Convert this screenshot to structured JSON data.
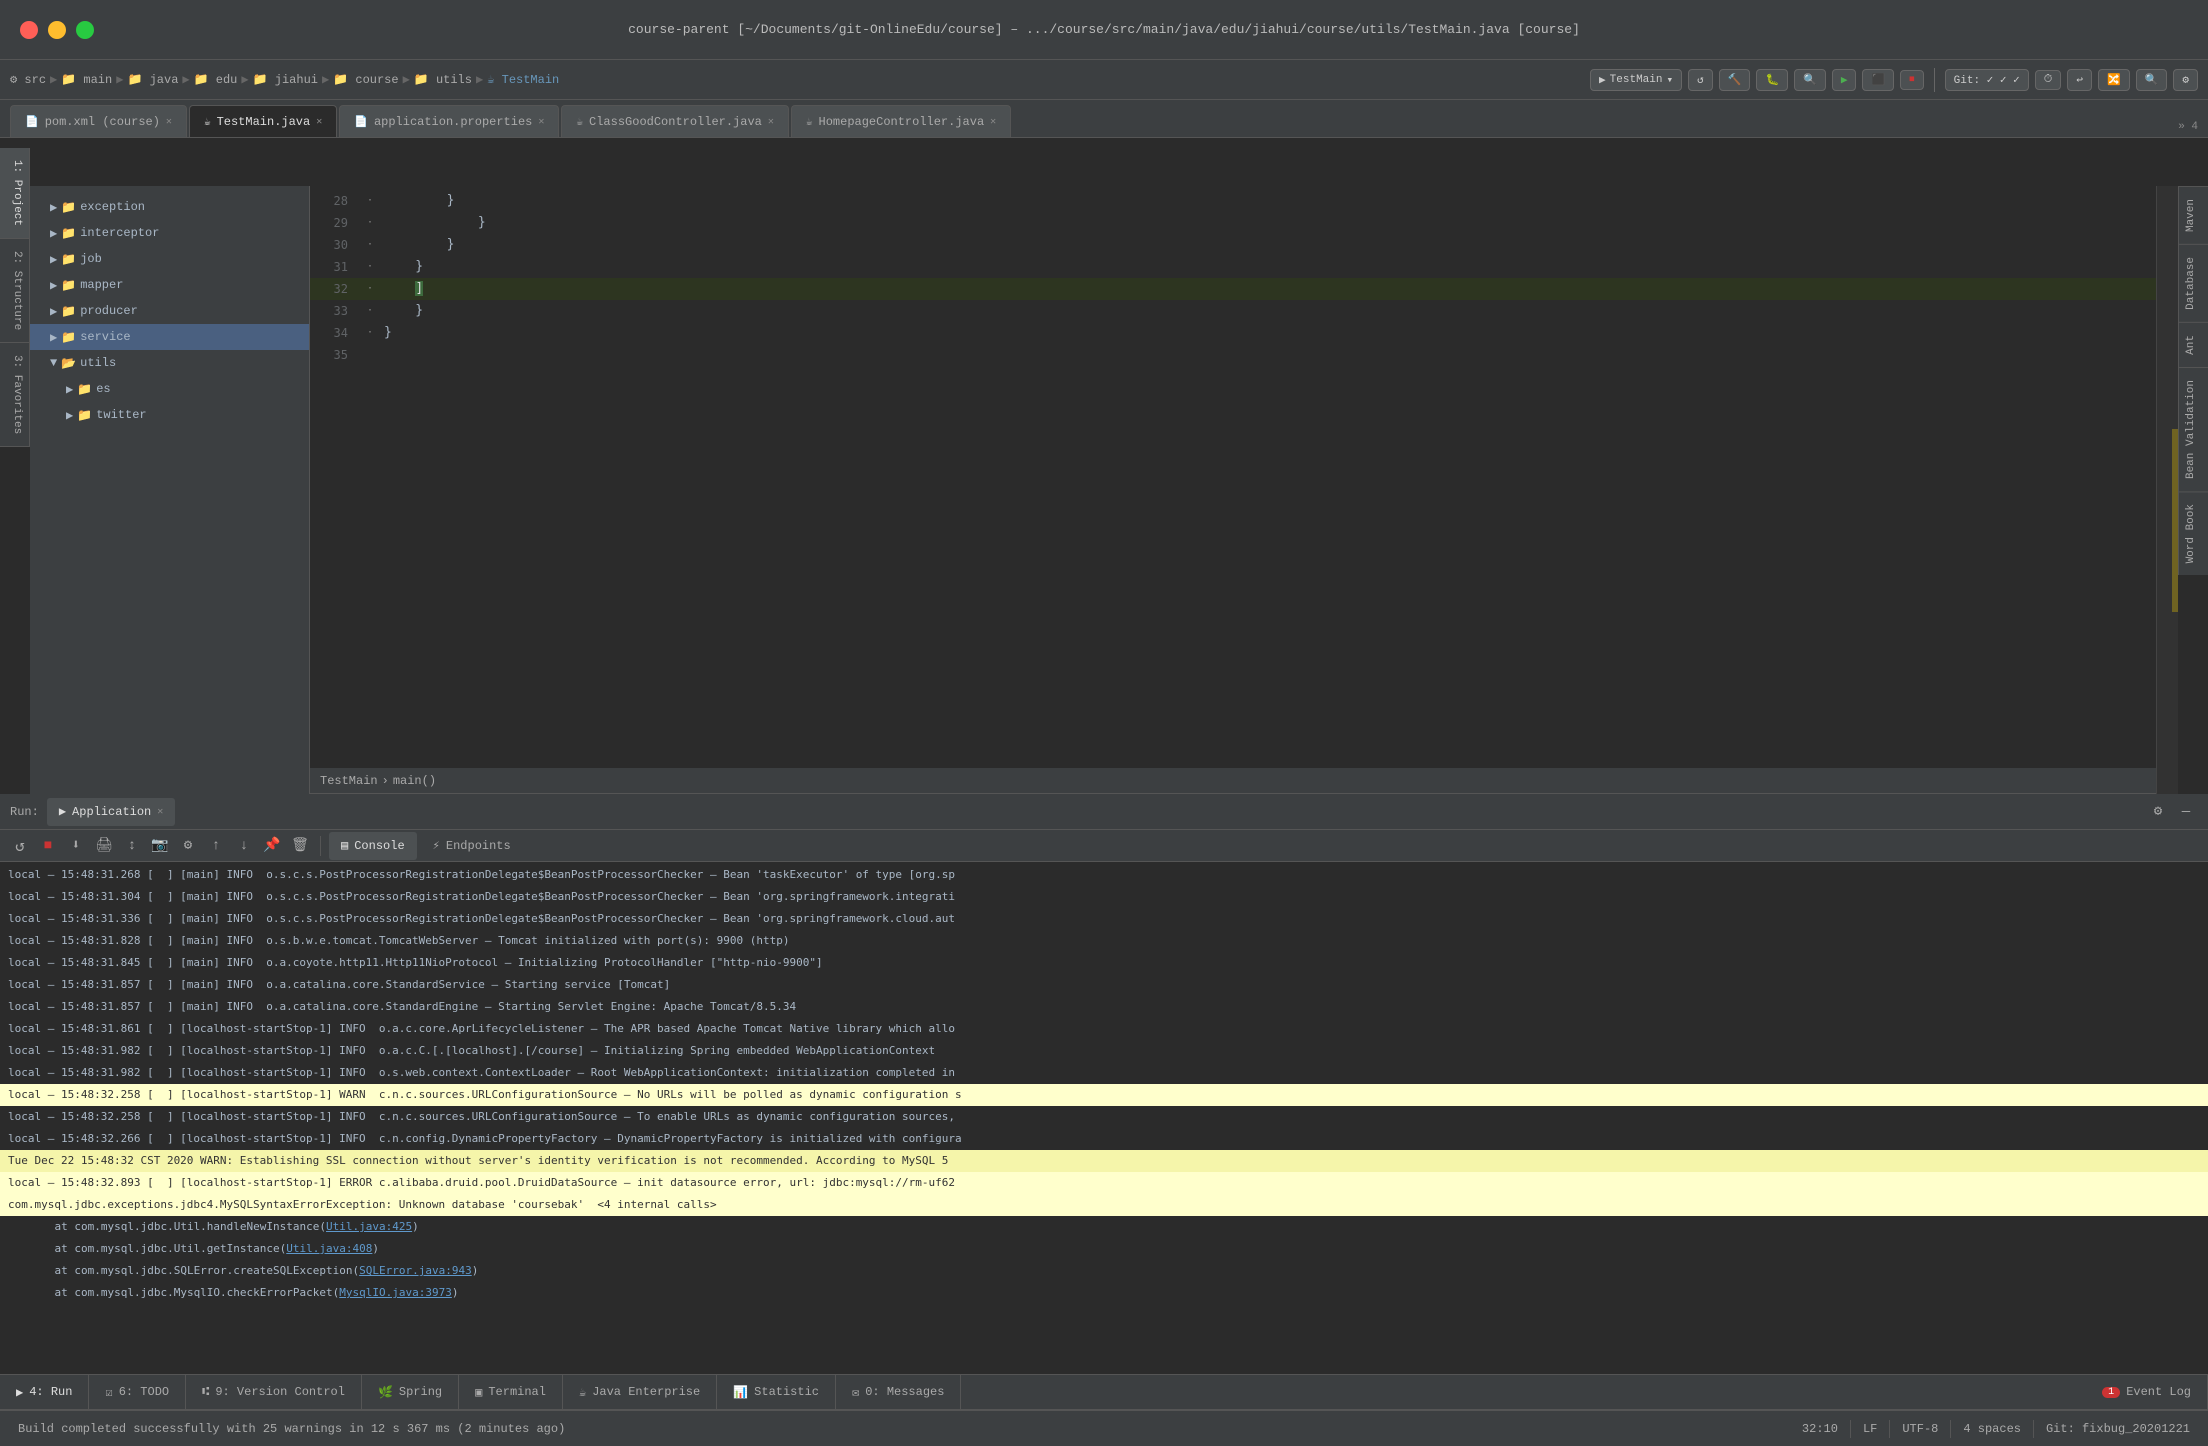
{
  "titlebar": {
    "title": "course-parent [~/Documents/git-OnlineEdu/course] – .../course/src/main/java/edu/jiahui/course/utils/TestMain.java [course]"
  },
  "breadcrumb": {
    "items": [
      "src",
      "main",
      "java",
      "edu",
      "jiahui",
      "course",
      "utils",
      "TestMain"
    ]
  },
  "tabs": [
    {
      "label": "pom.xml",
      "subtitle": "course",
      "active": false,
      "icon": "📄"
    },
    {
      "label": "TestMain.java",
      "active": true,
      "icon": "☕"
    },
    {
      "label": "application.properties",
      "active": false,
      "icon": "📄"
    },
    {
      "label": "ClassGoodController.java",
      "active": false,
      "icon": "☕"
    },
    {
      "label": "HomepageController.java",
      "active": false,
      "icon": "☕"
    }
  ],
  "project_tree": {
    "items": [
      {
        "label": "exception",
        "type": "folder",
        "indent": 1
      },
      {
        "label": "interceptor",
        "type": "folder",
        "indent": 1
      },
      {
        "label": "job",
        "type": "folder",
        "indent": 1
      },
      {
        "label": "mapper",
        "type": "folder",
        "indent": 1
      },
      {
        "label": "producer",
        "type": "folder",
        "indent": 1
      },
      {
        "label": "service",
        "type": "folder",
        "indent": 1,
        "selected": true
      },
      {
        "label": "utils",
        "type": "folder",
        "indent": 1,
        "open": true
      },
      {
        "label": "es",
        "type": "folder",
        "indent": 2
      },
      {
        "label": "twitter",
        "type": "folder",
        "indent": 2
      }
    ]
  },
  "code_lines": [
    {
      "num": 28,
      "content": "        }"
    },
    {
      "num": 29,
      "content": "            }"
    },
    {
      "num": 30,
      "content": "        }"
    },
    {
      "num": 31,
      "content": "    }"
    },
    {
      "num": 32,
      "content": "    ]",
      "highlight": true
    },
    {
      "num": 33,
      "content": "    }"
    },
    {
      "num": 34,
      "content": "}"
    },
    {
      "num": 35,
      "content": ""
    }
  ],
  "editor_breadcrumb": {
    "path": "TestMain > main()"
  },
  "run_panel": {
    "label": "Run:",
    "active_tab": "Application",
    "tabs": [
      {
        "label": "Console",
        "icon": "▤"
      },
      {
        "label": "Endpoints",
        "icon": "⚡"
      }
    ]
  },
  "console_logs": [
    {
      "text": "local – 15:48:31.268 [  ] [main] INFO  o.s.c.s.PostProcessorRegistrationDelegate$BeanPostProcessorChecker – Bean 'taskExecutor' of type [org.sp",
      "type": "normal"
    },
    {
      "text": "local – 15:48:31.304 [  ] [main] INFO  o.s.c.s.PostProcessorRegistrationDelegate$BeanPostProcessorChecker – Bean 'org.springframework.integrati",
      "type": "normal"
    },
    {
      "text": "local – 15:48:31.336 [  ] [main] INFO  o.s.c.s.PostProcessorRegistrationDelegate$BeanPostProcessorChecker – Bean 'org.springframework.cloud.aut",
      "type": "normal"
    },
    {
      "text": "local – 15:48:31.828 [  ] [main] INFO  o.s.b.w.e.tomcat.TomcatWebServer – Tomcat initialized with port(s): 9900 (http)",
      "type": "normal"
    },
    {
      "text": "local – 15:48:31.845 [  ] [main] INFO  o.a.coyote.http11.Http11NioProtocol – Initializing ProtocolHandler [\"http-nio-9900\"]",
      "type": "normal"
    },
    {
      "text": "local – 15:48:31.857 [  ] [main] INFO  o.a.catalina.core.StandardService – Starting service [Tomcat]",
      "type": "normal"
    },
    {
      "text": "local – 15:48:31.857 [  ] [main] INFO  o.a.catalina.core.StandardEngine – Starting Servlet Engine: Apache Tomcat/8.5.34",
      "type": "normal"
    },
    {
      "text": "local – 15:48:31.861 [  ] [localhost-startStop-1] INFO  o.a.c.core.AprLifecycleListener – The APR based Apache Tomcat Native library which allo",
      "type": "normal"
    },
    {
      "text": "local – 15:48:31.982 [  ] [localhost-startStop-1] INFO  o.a.c.C.[.[localhost].[/course] – Initializing Spring embedded WebApplicationContext",
      "type": "normal"
    },
    {
      "text": "local – 15:48:31.982 [  ] [localhost-startStop-1] INFO  o.s.web.context.ContextLoader – Root WebApplicationContext: initialization completed in",
      "type": "normal"
    },
    {
      "text": "local – 15:48:32.258 [  ] [localhost-startStop-1] WARN  c.n.c.sources.URLConfigurationSource – No URLs will be polled as dynamic configuration s",
      "type": "warn"
    },
    {
      "text": "local – 15:48:32.258 [  ] [localhost-startStop-1] INFO  c.n.c.sources.URLConfigurationSource – To enable URLs as dynamic configuration sources,",
      "type": "normal"
    },
    {
      "text": "local – 15:48:32.266 [  ] [localhost-startStop-1] INFO  c.n.config.DynamicPropertyFactory – DynamicPropertyFactory is initialized with configura",
      "type": "normal"
    },
    {
      "text": "Tue Dec 22 15:48:32 CST 2020 WARN: Establishing SSL connection without server's identity verification is not recommended. According to MySQL 5",
      "type": "warn"
    },
    {
      "text": "local – 15:48:32.893 [  ] [localhost-startStop-1] ERROR c.alibaba.druid.pool.DruidDataSource – init datasource error, url: jdbc:mysql://rm-uf62",
      "type": "error"
    },
    {
      "text": "com.mysql.jdbc.exceptions.jdbc4.MySQLSyntaxErrorException: Unknown database 'coursebak'  <4 internal calls>",
      "type": "error"
    },
    {
      "text": "    at com.mysql.jdbc.Util.handleNewInstance(Util.java:425)",
      "type": "stack",
      "link": "Util.java:425"
    },
    {
      "text": "    at com.mysql.jdbc.Util.getInstance(Util.java:408)",
      "type": "stack",
      "link": "Util.java:408"
    },
    {
      "text": "    at com.mysql.jdbc.SQLError.createSQLException(SQLError.java:943)",
      "type": "stack",
      "link": "SQLError.java:943"
    },
    {
      "text": "    at com.mysql.jdbc.MysqlIO.checkErrorPacket(MysqlIO.java:3973)",
      "type": "stack",
      "link": "MysqlIO.java:3973"
    }
  ],
  "bottom_nav": {
    "items": [
      {
        "label": "4: Run",
        "icon": "▶",
        "active": true
      },
      {
        "label": "6: TODO",
        "icon": "☑"
      },
      {
        "label": "9: Version Control",
        "icon": "⑆"
      },
      {
        "label": "Spring",
        "icon": "🌿"
      },
      {
        "label": "Terminal",
        "icon": "▣"
      },
      {
        "label": "Java Enterprise",
        "icon": "☕"
      },
      {
        "label": "Statistic",
        "icon": "📊"
      },
      {
        "label": "0: Messages",
        "icon": "✉"
      }
    ],
    "event_log": {
      "label": "Event Log",
      "count": "1"
    }
  },
  "status_bar": {
    "message": "Build completed successfully with 25 warnings in 12 s 367 ms (2 minutes ago)",
    "position": "32:10",
    "line_separator": "LF",
    "encoding": "UTF-8",
    "indent": "4 spaces",
    "git": "Git: fixbug_20201221"
  },
  "right_sidebar_tabs": [
    "Maven",
    "Database",
    "Ant",
    "Bean Validation",
    "Word Book"
  ],
  "left_sidebar_tabs": [
    "1: Project",
    "2: Structure",
    "3: Favorites"
  ]
}
